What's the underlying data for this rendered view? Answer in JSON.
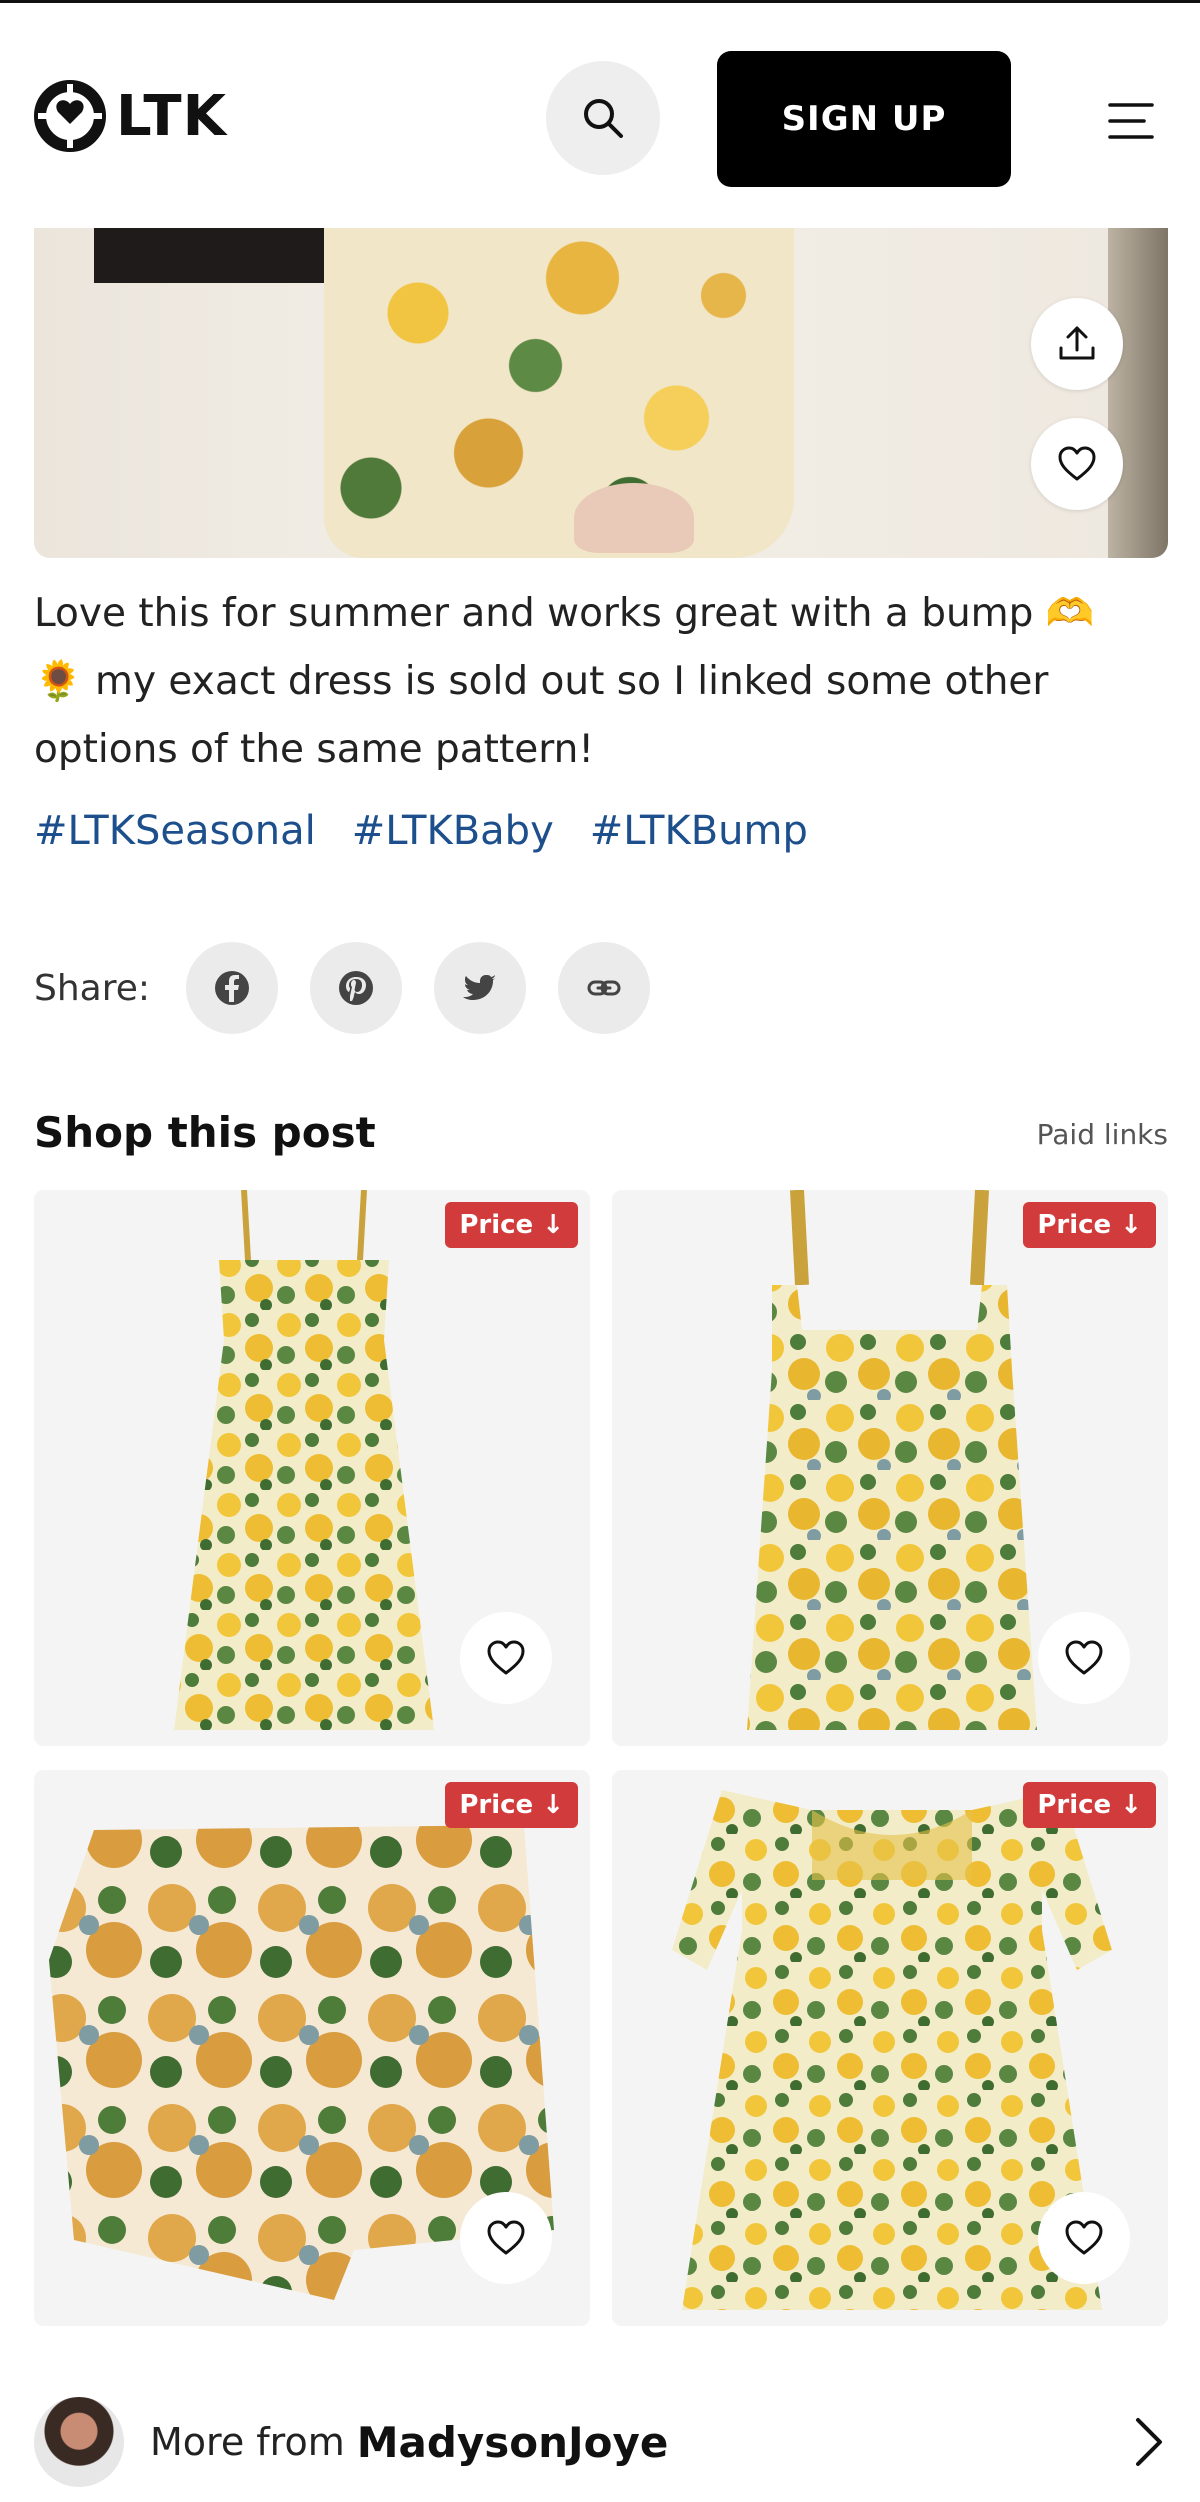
{
  "header": {
    "logo_text": "LTK",
    "signup_label": "SIGN UP"
  },
  "post": {
    "caption_line1": "Love this for summer and works great with a bump 🫶",
    "caption_line2": "🌻 my exact dress is sold out so I linked some other",
    "caption_line3": "options of the same pattern!",
    "hashtags": [
      "#LTKSeasonal",
      "#LTKBaby",
      "#LTKBump"
    ]
  },
  "share": {
    "label": "Share:"
  },
  "shop": {
    "title": "Shop this post",
    "paid_links": "Paid links",
    "products": [
      {
        "badge": "Price ↓"
      },
      {
        "badge": "Price ↓"
      },
      {
        "badge": "Price ↓"
      },
      {
        "badge": "Price ↓"
      }
    ]
  },
  "more_from": {
    "prefix": "More from",
    "creator": "MadysonJoye"
  },
  "colors": {
    "accent_black": "#000000",
    "hashtag_blue": "#1d4f8c",
    "price_badge_red": "#d23b3b"
  },
  "icons": [
    "ltk-logo-icon",
    "search-icon",
    "menu-icon",
    "upload-share-icon",
    "heart-icon",
    "facebook-icon",
    "pinterest-icon",
    "twitter-icon",
    "link-icon",
    "arrow-down-icon",
    "chevron-right-icon"
  ]
}
